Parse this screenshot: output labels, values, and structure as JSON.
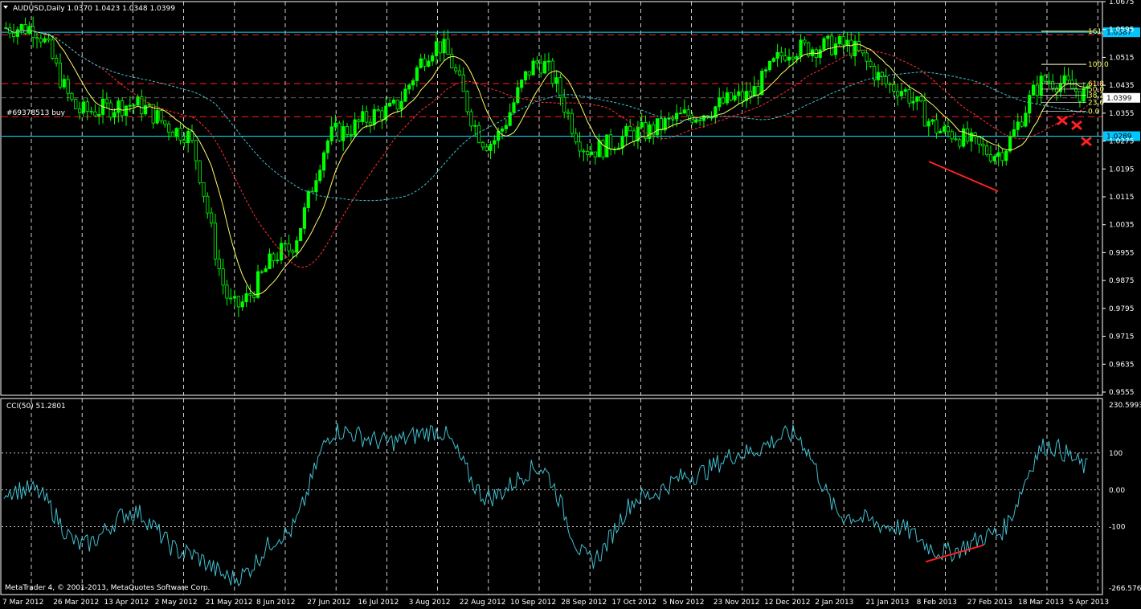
{
  "main_panel": {
    "symbol_line": "AUDUSD,Daily  1.0370 1.0423 1.0348 1.0399",
    "order_label": "#69378513 buy",
    "ylim": [
      0.9555,
      1.0675
    ],
    "y_ticks": [
      "1.0675",
      "1.0595",
      "1.0515",
      "1.0435",
      "1.0355",
      "1.0275",
      "1.0195",
      "1.0115",
      "1.0035",
      "0.9955",
      "0.9875",
      "0.9795",
      "0.9715",
      "0.9635",
      "0.9555"
    ],
    "price_tags": [
      {
        "label": "1.0587",
        "value": 1.0587,
        "color": "#00c8ff"
      },
      {
        "label": "1.0399",
        "value": 1.0399,
        "color": "#ffffff"
      },
      {
        "label": "1.0289",
        "value": 1.0289,
        "color": "#00c8ff"
      }
    ],
    "fib_levels": [
      {
        "label": "161.8",
        "value": 1.059
      },
      {
        "label": "100.0",
        "value": 1.0495
      },
      {
        "label": "61.8",
        "value": 1.044
      },
      {
        "label": "50.0",
        "value": 1.0424
      },
      {
        "label": "38.2",
        "value": 1.0406
      },
      {
        "label": "23.6",
        "value": 1.0386
      },
      {
        "label": "0.0",
        "value": 1.036
      }
    ]
  },
  "cci_panel": {
    "label": "CCI(50) 51.2801",
    "ylim": [
      -266.5763,
      230.5993
    ],
    "y_ticks": [
      {
        "label": "230.5993",
        "value": 230.5993
      },
      {
        "label": "100",
        "value": 100
      },
      {
        "label": "0.00",
        "value": 0
      },
      {
        "label": "-100",
        "value": -100
      },
      {
        "label": "-266.5763",
        "value": -266.5763
      }
    ]
  },
  "x_labels": [
    "7 Mar 2012",
    "26 Mar 2012",
    "13 Apr 2012",
    "2 May 2012",
    "21 May 2012",
    "8 Jun 2012",
    "27 Jun 2012",
    "16 Jul 2012",
    "3 Aug 2012",
    "22 Aug 2012",
    "10 Sep 2012",
    "28 Sep 2012",
    "17 Oct 2012",
    "5 Nov 2012",
    "23 Nov 2012",
    "12 Dec 2012",
    "2 Jan 2013",
    "21 Jan 2013",
    "8 Feb 2013",
    "27 Feb 2013",
    "18 Mar 2013",
    "5 Apr 2013"
  ],
  "copyright": "MetaTrader 4, © 2001-2013, MetaQuotes Software Corp.",
  "colors": {
    "background": "#000000",
    "candle": "#00ff00",
    "ma_yellow": "#ffff66",
    "ma_red": "#ff3030",
    "ma_cyan": "#40c0d0",
    "cci": "#40c0d0",
    "hline_cyan": "#00e5ff",
    "hline_red": "#ff2020",
    "divergence": "#ff2020"
  },
  "chart_data": [
    {
      "type": "line",
      "title": "AUDUSD,Daily",
      "description_ohlc": {
        "open": 1.037,
        "high": 1.0423,
        "low": 1.0348,
        "close": 1.0399
      },
      "x": [
        "7 Mar 2012",
        "26 Mar 2012",
        "13 Apr 2012",
        "2 May 2012",
        "21 May 2012",
        "8 Jun 2012",
        "27 Jun 2012",
        "16 Jul 2012",
        "3 Aug 2012",
        "22 Aug 2012",
        "10 Sep 2012",
        "28 Sep 2012",
        "17 Oct 2012",
        "5 Nov 2012",
        "23 Nov 2012",
        "12 Dec 2012",
        "2 Jan 2013",
        "21 Jan 2013",
        "8 Feb 2013",
        "27 Feb 2013",
        "18 Mar 2013",
        "5 Apr 2013"
      ],
      "series": [
        {
          "values": [
            1.06,
            1.036,
            1.038,
            1.03,
            0.98,
            0.996,
            1.03,
            1.036,
            1.055,
            1.027,
            1.05,
            1.025,
            1.03,
            1.035,
            1.04,
            1.054,
            1.055,
            1.043,
            1.03,
            1.024,
            1.045,
            1.04
          ]
        }
      ],
      "ylim": [
        0.9555,
        1.0675
      ]
    },
    {
      "type": "line",
      "title": "CCI(50) 51.2801",
      "x": [
        "7 Mar 2012",
        "26 Mar 2012",
        "13 Apr 2012",
        "2 May 2012",
        "21 May 2012",
        "8 Jun 2012",
        "27 Jun 2012",
        "16 Jul 2012",
        "3 Aug 2012",
        "22 Aug 2012",
        "10 Sep 2012",
        "28 Sep 2012",
        "17 Oct 2012",
        "5 Nov 2012",
        "23 Nov 2012",
        "12 Dec 2012",
        "2 Jan 2013",
        "21 Jan 2013",
        "8 Feb 2013",
        "27 Feb 2013",
        "18 Mar 2013",
        "5 Apr 2013"
      ],
      "series": [
        {
          "values": [
            0,
            -150,
            -60,
            -170,
            -240,
            -120,
            160,
            130,
            160,
            -20,
            60,
            -190,
            -20,
            40,
            100,
            150,
            -70,
            -100,
            -170,
            -120,
            120,
            51
          ]
        }
      ],
      "ylim": [
        -266.5763,
        230.5993
      ]
    }
  ]
}
